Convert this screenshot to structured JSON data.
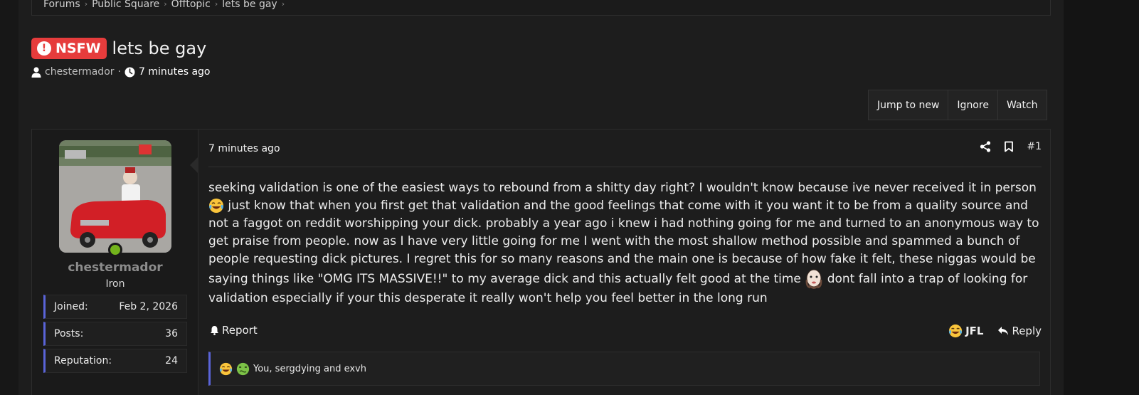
{
  "breadcrumbs": [
    "Forums",
    "Public Square",
    "Offtopic",
    "lets be gay"
  ],
  "thread": {
    "badge": "NSFW",
    "title": "lets be gay",
    "author": "chestermador",
    "separator": "·",
    "time": "7 minutes ago"
  },
  "actions": {
    "jump_to_new": "Jump to new",
    "ignore": "Ignore",
    "watch": "Watch"
  },
  "post": {
    "user": {
      "name": "chestermador",
      "title": "Iron",
      "stats": [
        {
          "label": "Joined:",
          "value": "Feb 2, 2026"
        },
        {
          "label": "Posts:",
          "value": "36"
        },
        {
          "label": "Reputation:",
          "value": "24"
        }
      ]
    },
    "date": "7 minutes ago",
    "number": "#1",
    "body": {
      "part1": "seeking validation is one of the easiest ways to rebound from a shitty day right? I wouldn't know because ive never received it in person",
      "part2": "just know that when you first get that validation and the good feelings that come with it you want it to be from a quality source and not a faggot on reddit worshipping your dick. probably a year ago i knew i had nothing going for me and turned to an anonymous way to get praise from people. now as I have very little going for me I went with the most shallow method possible and spammed a bunch of people requesting dick pictures. I regret this for so many reasons and the main one is because of how fake it felt, these niggas would be saying things like \"OMG ITS MASSIVE!!\" to my average dick and this actually felt good at the time",
      "part3": "dont fall into a trap of looking for validation especially if your this desperate it really won't help you feel better in the long run"
    },
    "report": "Report",
    "reaction_label": "JFL",
    "reply": "Reply",
    "reactions_text": "You, sergdying and exvh"
  },
  "icons": {
    "meta_user": "user-icon",
    "meta_clock": "clock-icon",
    "share": "share-icon",
    "bookmark": "bookmark-icon",
    "report": "bell-icon",
    "reply": "reply-icon",
    "laugh": "crying-laughing-emoji-icon",
    "sick": "nauseated-emoji-icon",
    "wojak": "bald-man-emoji-icon"
  },
  "colors": {
    "accent": "#5a64d9",
    "nsfw": "#e63c3c",
    "online": "#73b41c",
    "background": "#1d1d1d"
  }
}
